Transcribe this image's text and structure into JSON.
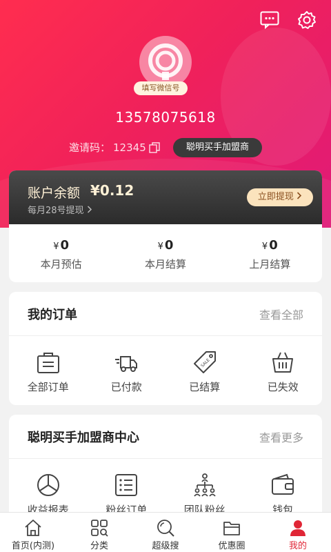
{
  "header": {
    "wechat_tag": "填写微信号",
    "phone": "13578075618",
    "invite_label": "邀请码：",
    "invite_code": "12345",
    "join_button": "聪明买手加盟商"
  },
  "balance": {
    "label": "账户余额",
    "value": "¥0.12",
    "sub": "每月28号提现",
    "withdraw_button": "立即提现",
    "stats": [
      {
        "currency": "¥",
        "value": "0",
        "label": "本月预估"
      },
      {
        "currency": "¥",
        "value": "0",
        "label": "本月结算"
      },
      {
        "currency": "¥",
        "value": "0",
        "label": "上月结算"
      }
    ]
  },
  "orders": {
    "title": "我的订单",
    "more": "查看全部",
    "items": [
      {
        "label": "全部订单",
        "icon": "bag-icon"
      },
      {
        "label": "已付款",
        "icon": "truck-icon"
      },
      {
        "label": "已结算",
        "icon": "tag-icon"
      },
      {
        "label": "已失效",
        "icon": "basket-icon"
      }
    ]
  },
  "center": {
    "title": "聪明买手加盟商中心",
    "more": "查看更多",
    "items": [
      {
        "label": "收益报表",
        "icon": "pie-chart-icon"
      },
      {
        "label": "粉丝订单",
        "icon": "list-icon"
      },
      {
        "label": "团队粉丝",
        "icon": "team-icon"
      },
      {
        "label": "钱包",
        "icon": "wallet-icon"
      }
    ]
  },
  "tabbar": {
    "items": [
      {
        "label": "首页(内测)",
        "icon": "home-icon"
      },
      {
        "label": "分类",
        "icon": "category-icon"
      },
      {
        "label": "超级搜",
        "icon": "search-icon"
      },
      {
        "label": "优惠圈",
        "icon": "folder-icon"
      },
      {
        "label": "我的",
        "icon": "user-icon"
      }
    ],
    "active_color": "#e02636"
  },
  "colors": {
    "brand": "#ff2d4f",
    "gold": "#fff1d6"
  }
}
